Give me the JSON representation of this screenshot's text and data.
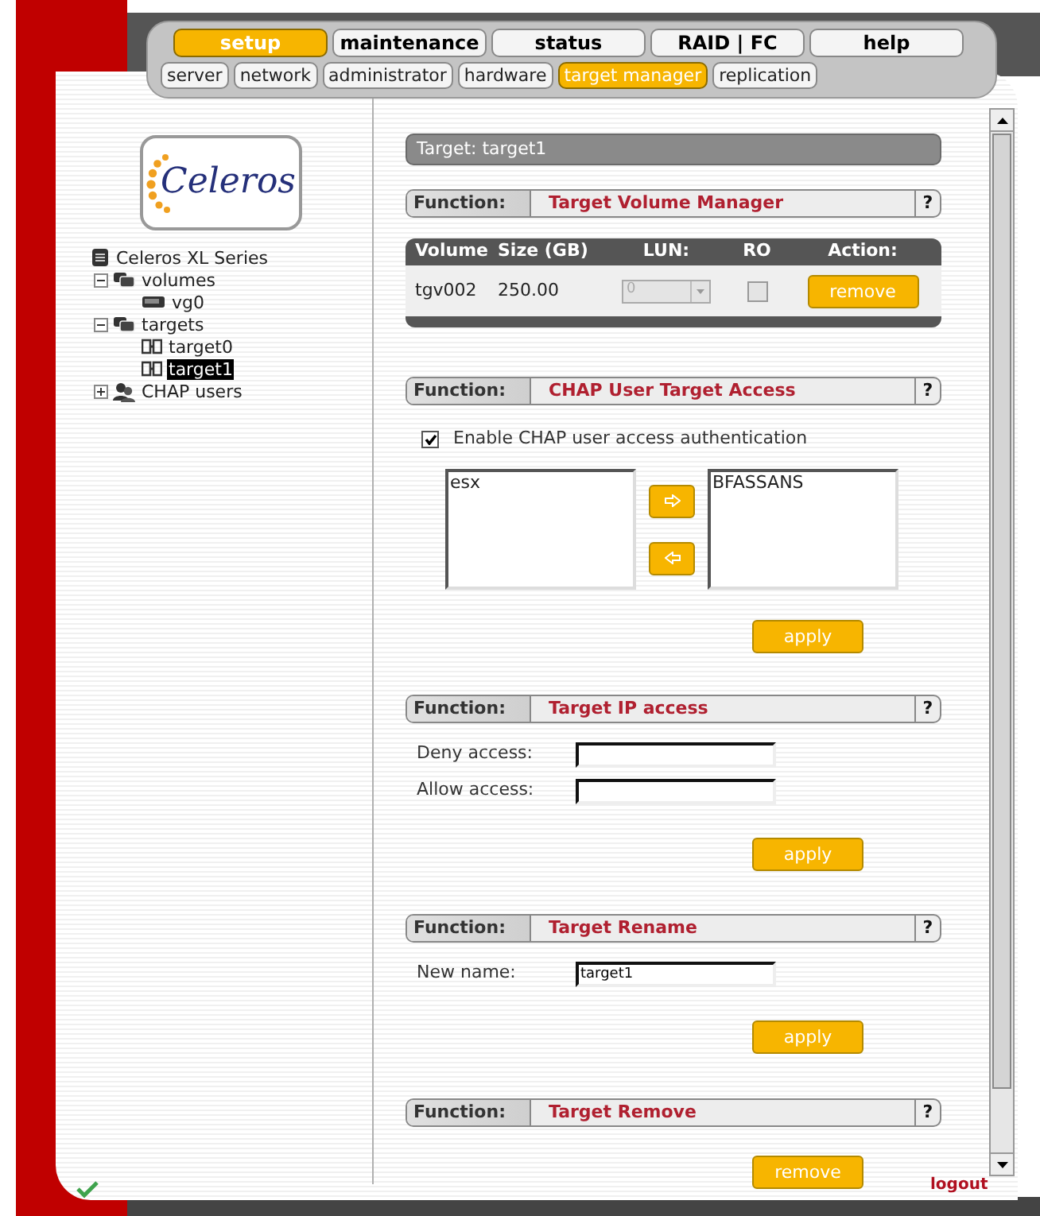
{
  "nav": {
    "main_tabs": [
      {
        "label": "setup",
        "selected": true
      },
      {
        "label": "maintenance",
        "selected": false
      },
      {
        "label": "status",
        "selected": false
      },
      {
        "label": "RAID | FC",
        "selected": false
      },
      {
        "label": "help",
        "selected": false
      }
    ],
    "sub_tabs": [
      {
        "label": "server",
        "selected": false
      },
      {
        "label": "network",
        "selected": false
      },
      {
        "label": "administrator",
        "selected": false
      },
      {
        "label": "hardware",
        "selected": false
      },
      {
        "label": "target manager",
        "selected": true
      },
      {
        "label": "replication",
        "selected": false
      }
    ]
  },
  "sidebar": {
    "logo_text": "Celeros",
    "tree": [
      {
        "label": "Celeros XL Series",
        "kind": "root",
        "selected": false,
        "children": [
          {
            "label": "volumes",
            "kind": "folder",
            "expanded": true,
            "selected": false,
            "children": [
              {
                "label": "vg0",
                "kind": "volume",
                "selected": false
              }
            ]
          },
          {
            "label": "targets",
            "kind": "folder",
            "expanded": true,
            "selected": false,
            "children": [
              {
                "label": "target0",
                "kind": "target",
                "selected": false
              },
              {
                "label": "target1",
                "kind": "target",
                "selected": true
              }
            ]
          },
          {
            "label": "CHAP users",
            "kind": "users",
            "expanded": false,
            "selected": false
          }
        ]
      }
    ]
  },
  "page_title": "Target: target1",
  "sections": [
    {
      "kind": "volumes",
      "function_label": "Function:",
      "title": "Target Volume Manager",
      "help": "?",
      "table": {
        "columns": [
          "Volume",
          "Size (GB)",
          "LUN:",
          "RO",
          "Action:"
        ],
        "rows": [
          {
            "volume": "tgv002",
            "size": "250.00",
            "lun": {
              "value": "0",
              "disabled": true
            },
            "ro": {
              "checked": false,
              "disabled": true
            },
            "action": "remove"
          }
        ]
      }
    },
    {
      "kind": "chap",
      "function_label": "Function:",
      "title": "CHAP User Target Access",
      "help": "?",
      "checkbox": {
        "label": "Enable CHAP user access authentication",
        "checked": true
      },
      "available": [
        "esx"
      ],
      "assigned": [
        "BFASSANS"
      ],
      "button": "apply"
    },
    {
      "kind": "fields",
      "function_label": "Function:",
      "title": "Target IP access",
      "help": "?",
      "fields": [
        {
          "label": "Deny access:"
        },
        {
          "label": "Allow access:"
        }
      ],
      "button": "apply"
    },
    {
      "kind": "fields",
      "function_label": "Function:",
      "title": "Target Rename",
      "help": "?",
      "fields": [
        {
          "label": "New name:",
          "value": "target1"
        }
      ],
      "button": "apply"
    },
    {
      "kind": "button",
      "function_label": "Function:",
      "title": "Target Remove",
      "help": "?",
      "button": "remove"
    }
  ],
  "footer": {
    "logout": "logout"
  }
}
